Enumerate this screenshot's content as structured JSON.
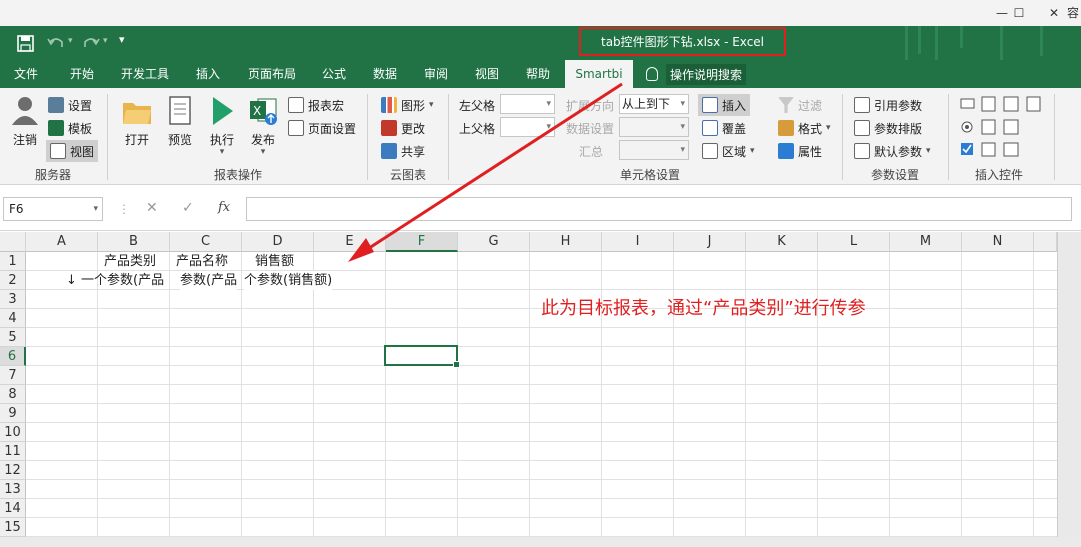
{
  "window": {
    "title": "tab控件图形下钻.xlsx  -  Excel",
    "controls": [
      "—",
      "☐",
      "✕"
    ],
    "side_fragment": "容"
  },
  "qat": {
    "save": "save-icon",
    "undo": "undo-icon",
    "redo": "redo-icon",
    "customize": "▾"
  },
  "tabs": [
    "文件",
    "开始",
    "开发工具",
    "插入",
    "页面布局",
    "公式",
    "数据",
    "审阅",
    "视图",
    "帮助",
    "Smartbi"
  ],
  "active_tab": "Smartbi",
  "tell_me": "操作说明搜索",
  "ribbon": {
    "server": {
      "label": "服务器",
      "logout": "注销",
      "settings": "设置",
      "template": "模板",
      "view": "视图"
    },
    "report_ops": {
      "label": "报表操作",
      "open": "打开",
      "preview": "预览",
      "execute": "执行",
      "publish": "发布",
      "report_macro": "报表宏",
      "page_setup": "页面设置"
    },
    "cloud_chart": {
      "label": "云图表",
      "chart": "图形",
      "change": "更改",
      "share": "共享"
    },
    "cell_settings": {
      "label": "单元格设置",
      "left_parent": "左父格",
      "top_parent": "上父格",
      "expand_dir": "扩展方向",
      "expand_value": "从上到下",
      "data_setting": "数据设置",
      "summary": "汇总",
      "insert": "插入",
      "overwrite": "覆盖",
      "region": "区域",
      "filter": "过滤",
      "format": "格式",
      "property": "属性"
    },
    "param_settings": {
      "label": "参数设置",
      "ref_param": "引用参数",
      "param_layout": "参数排版",
      "default_param": "默认参数"
    },
    "insert_control": {
      "label": "插入控件"
    }
  },
  "namebox": "F6",
  "formula_icons": {
    "cancel": "✕",
    "confirm": "✓",
    "fx": "fx"
  },
  "columns": [
    "A",
    "B",
    "C",
    "D",
    "E",
    "F",
    "G",
    "H",
    "I",
    "J",
    "K",
    "L",
    "M",
    "N"
  ],
  "rows": [
    "1",
    "2",
    "3",
    "4",
    "5",
    "6",
    "7",
    "8",
    "9",
    "10",
    "11",
    "12",
    "13",
    "14",
    "15"
  ],
  "cells": {
    "B1": "产品类别",
    "C1": "产品名称",
    "D1": "销售额",
    "A2": "↓ 一个参数(产品",
    "C2": "参数(产品",
    "D2": "个参数(销售额)"
  },
  "annotation": "此为目标报表，通过“产品类别”进行传参",
  "colors": {
    "excel_green": "#217346",
    "annotation_red": "#e02020"
  }
}
